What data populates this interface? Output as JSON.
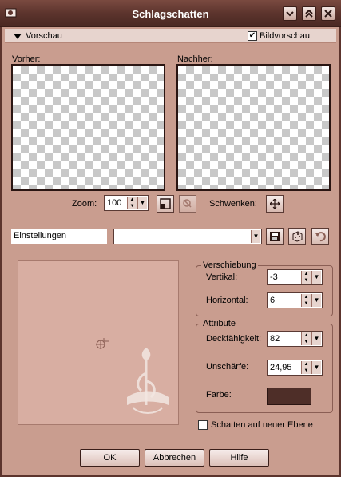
{
  "window": {
    "title": "Schlagschatten"
  },
  "preview": {
    "section_label": "Vorschau",
    "checkbox_label": "Bildvorschau",
    "checked": true,
    "before_label": "Vorher:",
    "after_label": "Nachher:"
  },
  "zoom": {
    "label": "Zoom:",
    "value": "100",
    "pan_label": "Schwenken:"
  },
  "settings": {
    "label": "Einstellungen",
    "value": ""
  },
  "offset": {
    "group_label": "Verschiebung",
    "vertical_label": "Vertikal:",
    "vertical_value": "-3",
    "horizontal_label": "Horizontal:",
    "horizontal_value": "6"
  },
  "attributes": {
    "group_label": "Attribute",
    "opacity_label": "Deckfähigkeit:",
    "opacity_value": "82",
    "blur_label": "Unschärfe:",
    "blur_value": "24,95",
    "color_label": "Farbe:",
    "color": "#4e2e28"
  },
  "shadow_layer": {
    "label": "Schatten auf neuer Ebene",
    "checked": false
  },
  "buttons": {
    "ok": "OK",
    "cancel": "Abbrechen",
    "help": "Hilfe"
  },
  "colors": {
    "accent": "#5c342d",
    "panel": "#c99d8f",
    "canvas": "#d8aea2"
  }
}
